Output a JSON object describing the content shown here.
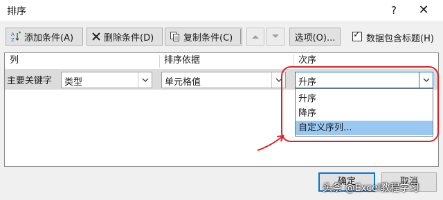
{
  "dialog": {
    "title": "排序",
    "help_label": "?",
    "close_label": "✕"
  },
  "toolbar": {
    "add_label": "添加条件(A)",
    "delete_label": "删除条件(D)",
    "copy_label": "复制条件(C)",
    "options_label": "选项(O)...",
    "header_checkbox_label": "数据包含标题(H)",
    "header_checkbox_checked": true
  },
  "grid": {
    "columns": [
      "列",
      "排序依据",
      "次序"
    ],
    "rows": [
      {
        "label": "主要关键字",
        "column_value": "类型",
        "sort_on": "单元格值",
        "order": "升序"
      }
    ]
  },
  "order_dropdown": {
    "options": [
      "升序",
      "降序",
      "自定义序列..."
    ],
    "highlighted_index": 2
  },
  "footer": {
    "ok_label": "确定",
    "cancel_label": "取消"
  },
  "watermark": "头条 @Excel教程学习",
  "colors": {
    "annotation": "#e02020",
    "highlight": "#99c9f2",
    "focus": "#0078d7"
  }
}
